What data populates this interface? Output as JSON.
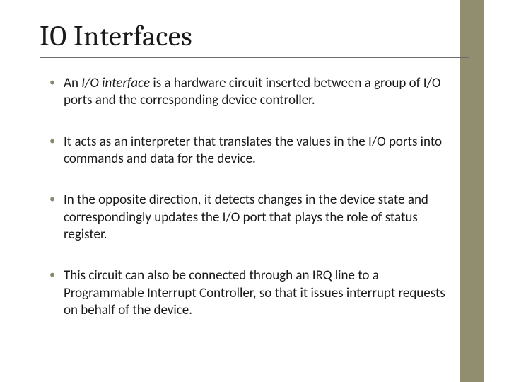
{
  "slide": {
    "title": "IO Interfaces",
    "bullets": [
      {
        "prefix": "An ",
        "italic": "I/O interface ",
        "rest": "is a hardware circuit inserted between a group of I/O ports and the corresponding device controller."
      },
      {
        "text": "It acts as an interpreter that translates the values in the I/O ports into commands and data for the device."
      },
      {
        "text": "In the opposite direction, it detects changes in the device state and correspondingly updates the I/O port that plays the role of status register."
      },
      {
        "text": "This circuit can also be connected through an IRQ line to a Programmable Interrupt Controller, so that it issues interrupt requests on behalf of the device."
      }
    ]
  },
  "colors": {
    "accent": "#908e6e"
  }
}
